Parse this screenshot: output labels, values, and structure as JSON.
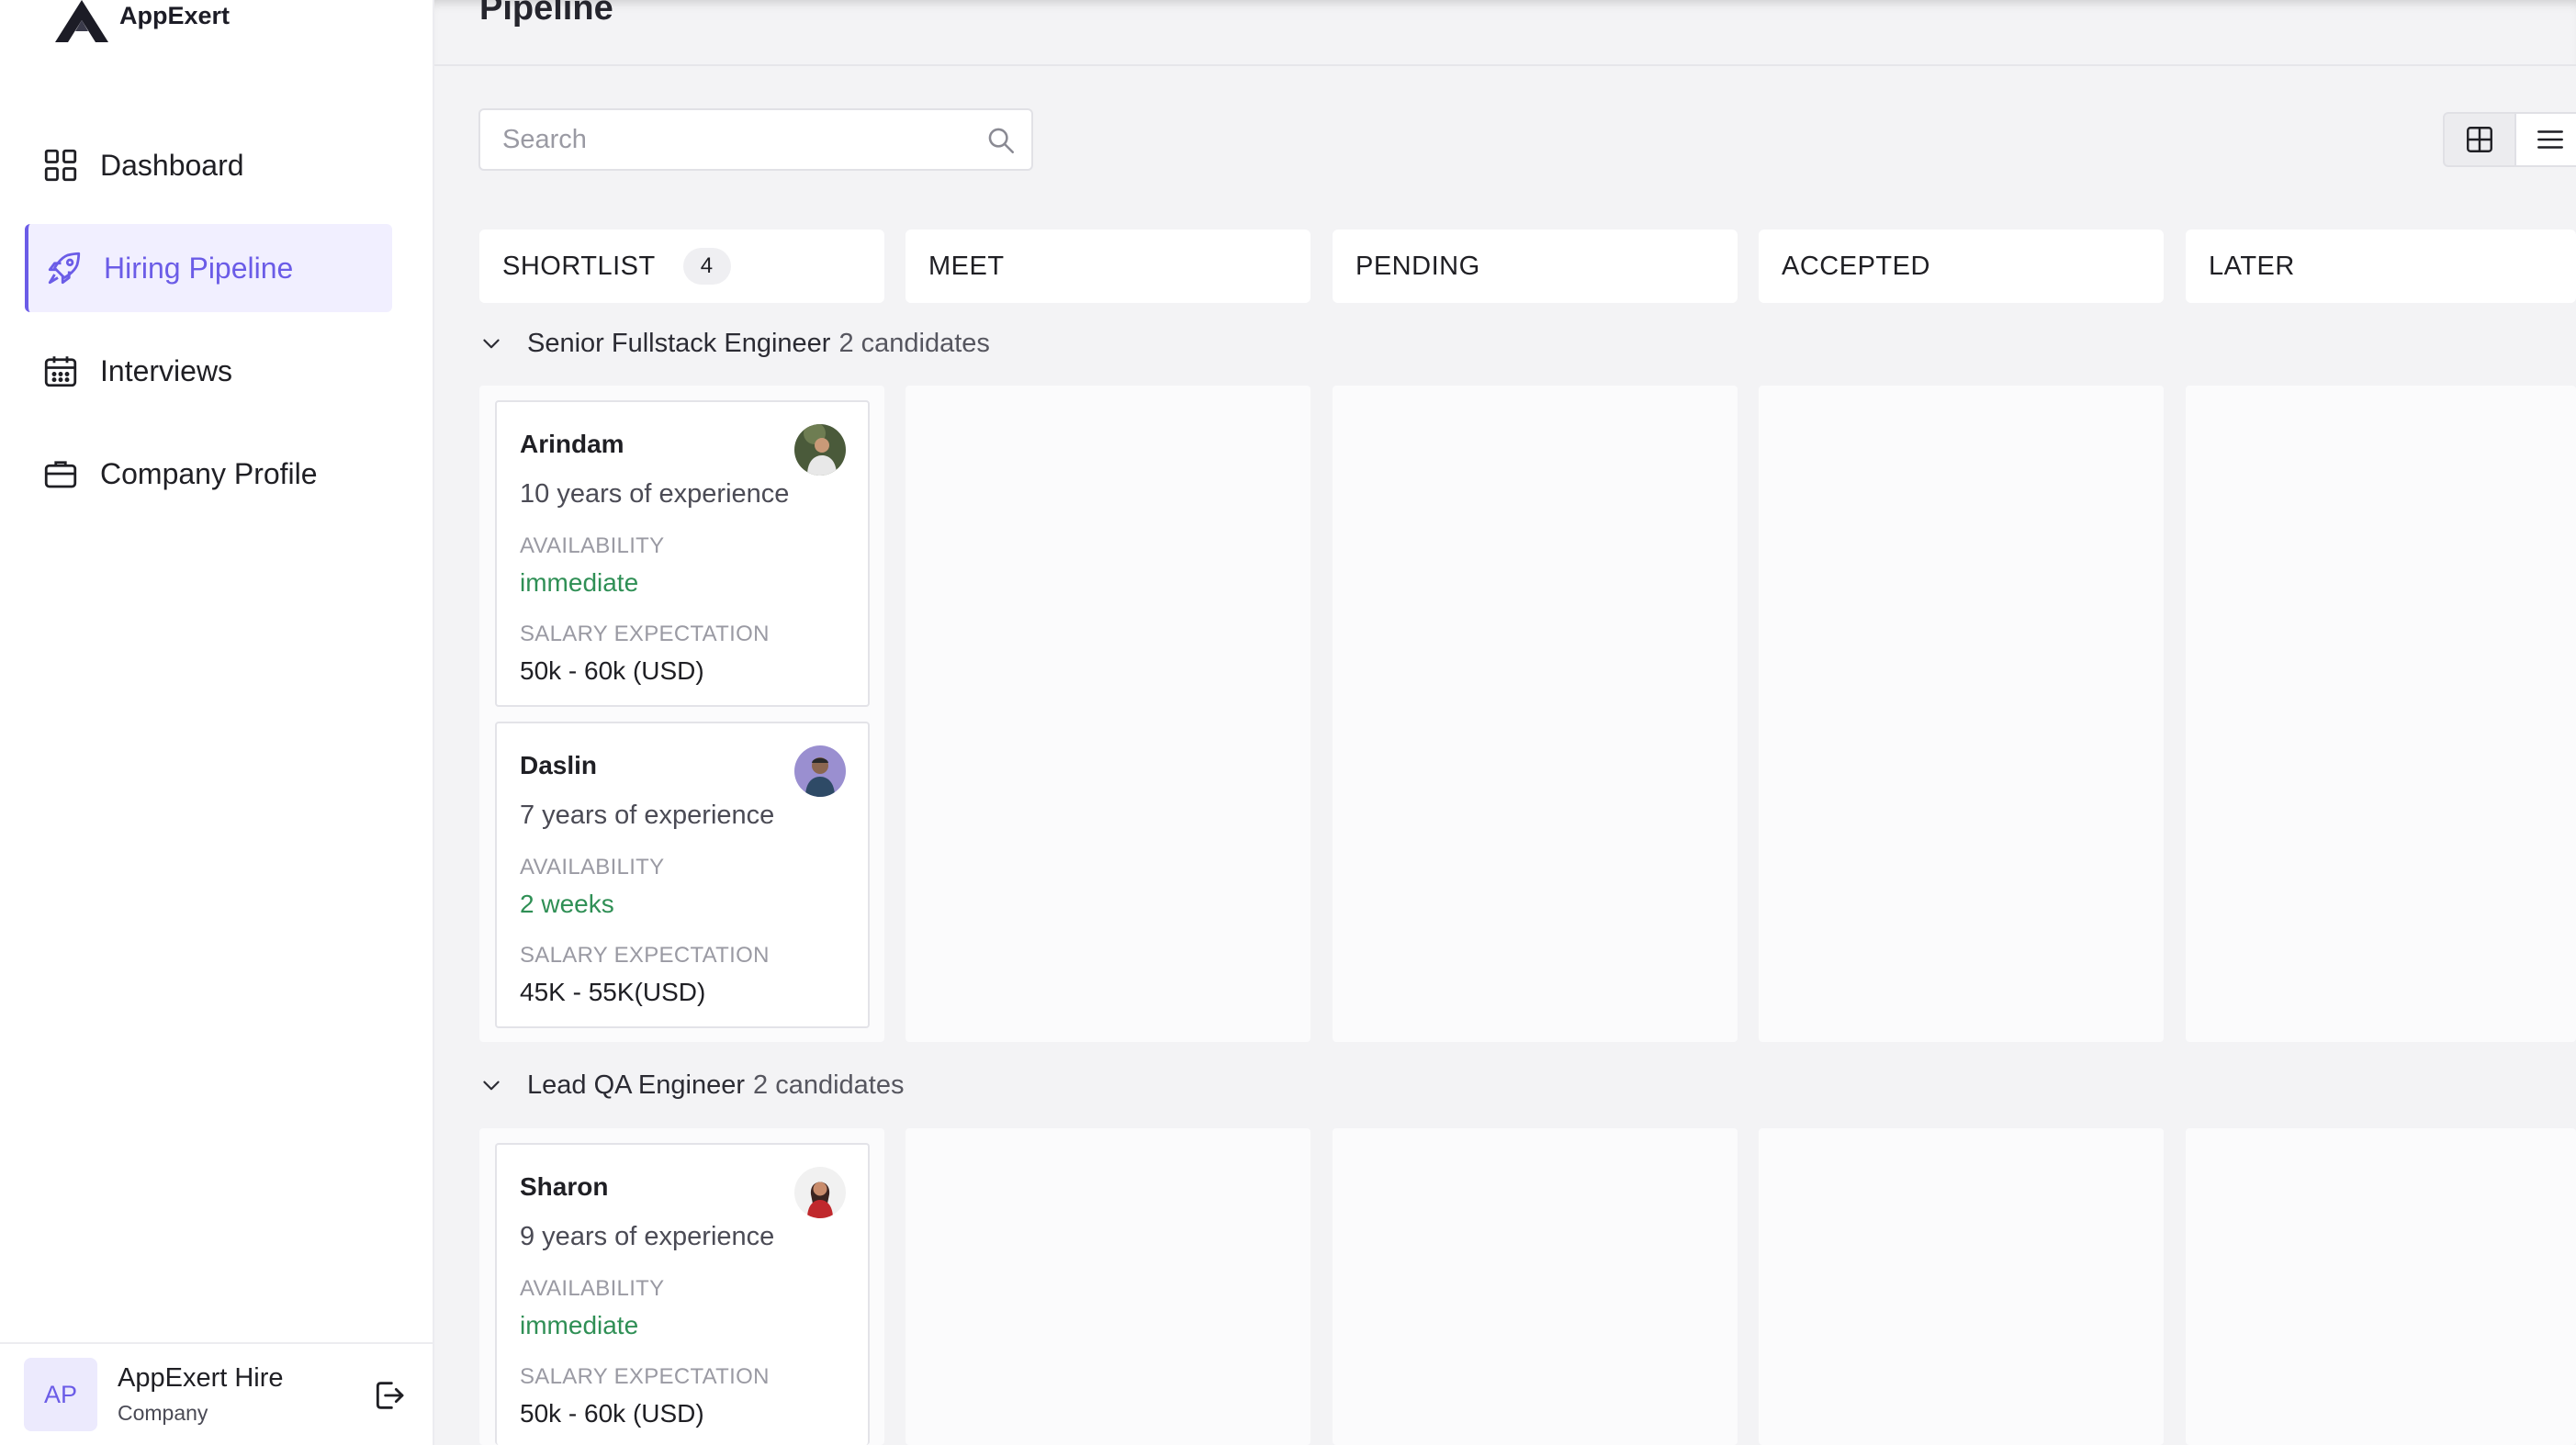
{
  "app": {
    "logo_text": "AppExert"
  },
  "sidebar": {
    "items": [
      {
        "label": "Dashboard"
      },
      {
        "label": "Hiring Pipeline"
      },
      {
        "label": "Interviews"
      },
      {
        "label": "Company Profile"
      }
    ],
    "footer": {
      "initials": "AP",
      "name": "AppExert Hire",
      "role": "Company"
    }
  },
  "header": {
    "title": "Pipeline"
  },
  "search": {
    "placeholder": "Search"
  },
  "columns": [
    {
      "label": "SHORTLIST",
      "count": "4"
    },
    {
      "label": "MEET"
    },
    {
      "label": "PENDING"
    },
    {
      "label": "ACCEPTED"
    },
    {
      "label": "LATER"
    }
  ],
  "groups": [
    {
      "title": "Senior Fullstack Engineer",
      "count_text": "2 candidates",
      "cards": [
        {
          "name": "Arindam",
          "experience": "10 years of experience",
          "availability_label": "AVAILABILITY",
          "availability": "immediate",
          "salary_label": "SALARY EXPECTATION",
          "salary": "50k - 60k (USD)"
        },
        {
          "name": "Daslin",
          "experience": "7 years of experience",
          "availability_label": "AVAILABILITY",
          "availability": "2 weeks",
          "salary_label": "SALARY EXPECTATION",
          "salary": "45K - 55K(USD)"
        }
      ]
    },
    {
      "title": "Lead QA Engineer",
      "count_text": "2 candidates",
      "cards": [
        {
          "name": "Sharon",
          "experience": "9 years of experience",
          "availability_label": "AVAILABILITY",
          "availability": "immediate",
          "salary_label": "SALARY EXPECTATION",
          "salary": "50k - 60k (USD)"
        }
      ]
    }
  ],
  "colors": {
    "accent": "#6b5ce7",
    "accent_bg": "#f1efff",
    "availability": "#2f8f55"
  }
}
